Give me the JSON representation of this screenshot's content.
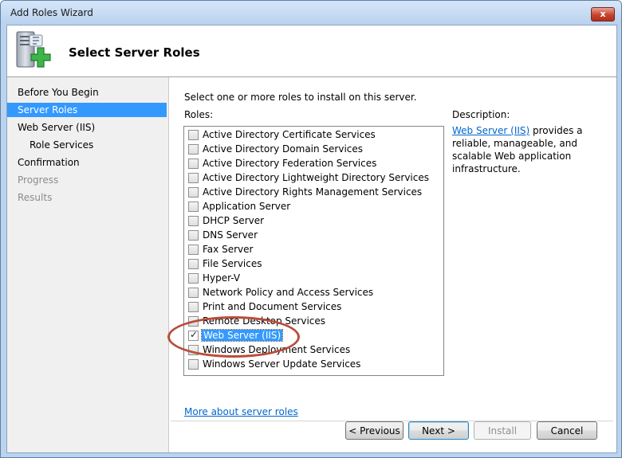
{
  "window": {
    "title": "Add Roles Wizard",
    "close_glyph": "x"
  },
  "header": {
    "title": "Select Server Roles",
    "icon": "server-add-icon"
  },
  "nav": [
    {
      "label": "Before You Begin",
      "state": "normal",
      "level": 0
    },
    {
      "label": "Server Roles",
      "state": "selected",
      "level": 0
    },
    {
      "label": "Web Server (IIS)",
      "state": "normal",
      "level": 0
    },
    {
      "label": "Role Services",
      "state": "normal",
      "level": 1
    },
    {
      "label": "Confirmation",
      "state": "normal",
      "level": 0
    },
    {
      "label": "Progress",
      "state": "disabled",
      "level": 0
    },
    {
      "label": "Results",
      "state": "disabled",
      "level": 0
    }
  ],
  "main": {
    "intro": "Select one or more roles to install on this server.",
    "roles_label": "Roles:",
    "roles": [
      {
        "label": "Active Directory Certificate Services",
        "checked": false
      },
      {
        "label": "Active Directory Domain Services",
        "checked": false
      },
      {
        "label": "Active Directory Federation Services",
        "checked": false
      },
      {
        "label": "Active Directory Lightweight Directory Services",
        "checked": false
      },
      {
        "label": "Active Directory Rights Management Services",
        "checked": false
      },
      {
        "label": "Application Server",
        "checked": false
      },
      {
        "label": "DHCP Server",
        "checked": false
      },
      {
        "label": "DNS Server",
        "checked": false
      },
      {
        "label": "Fax Server",
        "checked": false
      },
      {
        "label": "File Services",
        "checked": false
      },
      {
        "label": "Hyper-V",
        "checked": false
      },
      {
        "label": "Network Policy and Access Services",
        "checked": false
      },
      {
        "label": "Print and Document Services",
        "checked": false
      },
      {
        "label": "Remote Desktop Services",
        "checked": false
      },
      {
        "label": "Web Server (IIS)",
        "checked": true,
        "selected": true
      },
      {
        "label": "Windows Deployment Services",
        "checked": false
      },
      {
        "label": "Windows Server Update Services",
        "checked": false
      }
    ],
    "more_link": "More about server roles",
    "description_label": "Description:",
    "description_link": "Web Server (IIS)",
    "description_text": " provides a reliable, manageable, and scalable Web application infrastructure."
  },
  "buttons": {
    "previous": "< Previous",
    "next": "Next >",
    "install": "Install",
    "cancel": "Cancel"
  },
  "colors": {
    "selection": "#3399ff",
    "link": "#0066cc",
    "annotation": "#b84d3a"
  }
}
